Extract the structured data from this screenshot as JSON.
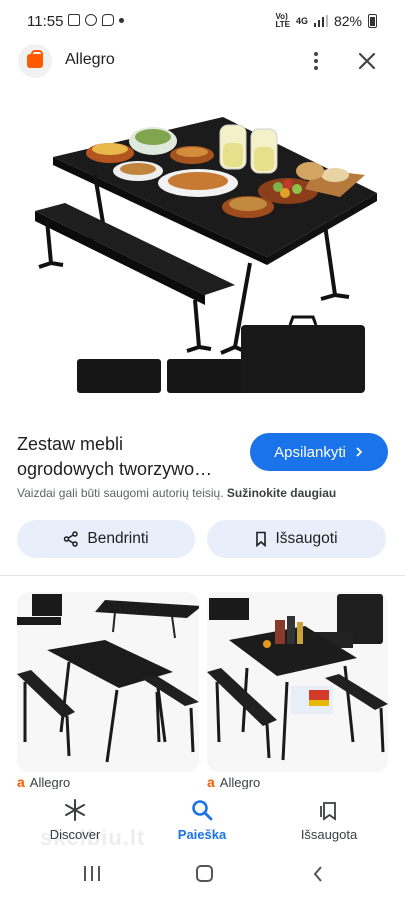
{
  "status": {
    "time": "11:55",
    "battery": "82%",
    "net_top": "Vo)",
    "net_bottom": "LTE",
    "signal_type": "4G"
  },
  "app": {
    "title": "Allegro"
  },
  "product": {
    "title_line1": "Zestaw mebli",
    "title_line2": "ogrodowych tworzywo…",
    "visit_label": "Apsilankyti",
    "copyright_text": "Vaizdai gali būti saugomi autorių teisių.",
    "copyright_link": "Sužinokite daugiau"
  },
  "actions": {
    "share_label": "Bendrinti",
    "save_label": "Išsaugoti"
  },
  "results": [
    {
      "source": "Allegro"
    },
    {
      "source": "Allegro"
    }
  ],
  "nav": {
    "discover": "Discover",
    "search": "Paieška",
    "saved": "Išsaugota"
  },
  "watermark": "skelbiu.lt",
  "colors": {
    "accent": "#1a73e8",
    "brand": "#ff5a00",
    "pill": "#e8eefa"
  }
}
